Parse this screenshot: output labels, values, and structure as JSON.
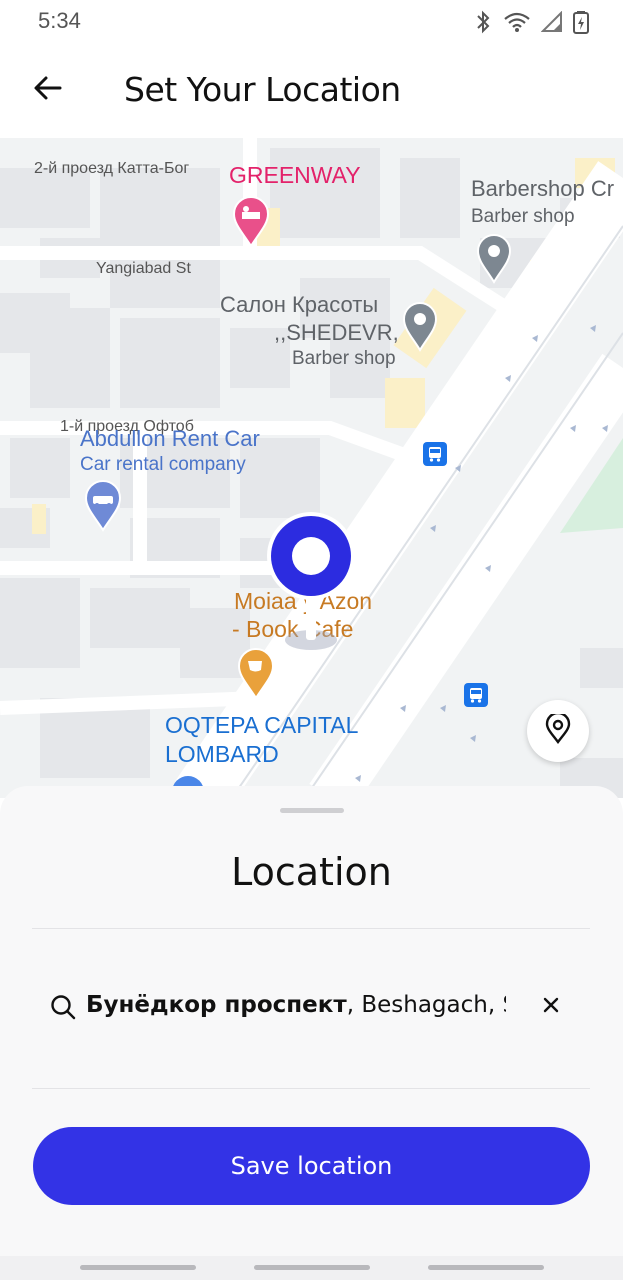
{
  "status_bar": {
    "time": "5:34",
    "icons": [
      "bluetooth-icon",
      "wifi-icon",
      "cellular-signal-icon",
      "battery-icon"
    ]
  },
  "header": {
    "title": "Set Your Location",
    "back_icon": "arrow-left-icon"
  },
  "map": {
    "streets": [
      "2-й проезд Катта-Бог",
      "Yangiabad St",
      "1-й проезд Офтоб"
    ],
    "pois": [
      {
        "name": "GREENWAY",
        "subtitle": "",
        "icon": "hotel-pin-icon",
        "color": "#e3226a"
      },
      {
        "name": "Barbershop Cr",
        "subtitle": "Barber shop",
        "icon": "gray-pin-icon",
        "color": "#5f6368"
      },
      {
        "name": "Салон Красоты",
        "name2": ",,SHEDEVR,",
        "subtitle": "Barber shop",
        "icon": "gray-pin-icon",
        "color": "#5f6368"
      },
      {
        "name": "Abdullon Rent Car",
        "subtitle": "Car rental company",
        "icon": "car-rental-pin-icon",
        "color": "#4a74c9"
      },
      {
        "name": "Moiaa  y Azon",
        "name2": "- Book Cafe",
        "subtitle": "",
        "icon": "cafe-pin-icon",
        "color": "#c77a23"
      },
      {
        "name": "OQTEPA CAPITAL",
        "name2": "LOMBARD",
        "subtitle": "",
        "icon": "blue-pin-icon",
        "color": "#1a6fd1"
      }
    ],
    "transit_icon": "bus-stop-icon",
    "center_pin_icon": "location-pin-icon",
    "locate_icon": "map-pin-outline-icon"
  },
  "sheet": {
    "title": "Location",
    "search": {
      "value_bold": "Бунёдкор проспект",
      "value_rest": ", Beshagach, S",
      "icon": "search-icon",
      "clear_icon": "close-icon"
    },
    "save_label": "Save location"
  },
  "colors": {
    "accent": "#3333e6",
    "pin_blue": "#2c2ce0"
  }
}
